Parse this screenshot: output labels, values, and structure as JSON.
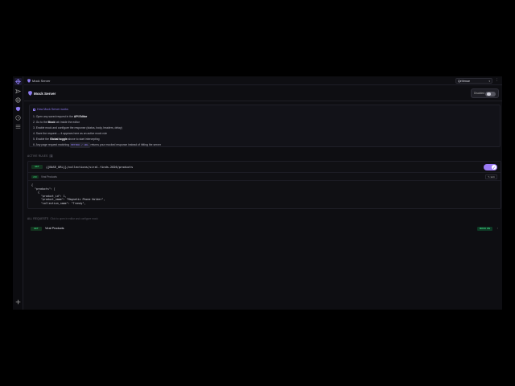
{
  "topbar": {
    "title": "Mock Server",
    "environment": "QeVenue",
    "menu_glyph": "⋮"
  },
  "header": {
    "title": "Mock Server",
    "global_toggle_label": "Disabled",
    "global_toggle_on": false
  },
  "howto": {
    "title": "How Mock Server works",
    "steps": [
      {
        "pre": "1. Open any saved request in the ",
        "bold": "API Editor",
        "post": ""
      },
      {
        "pre": "2. Go to the ",
        "bold": "Mock",
        "post": " tab inside the editor"
      },
      {
        "pre": "3. Enable mock and configure the response (status, body, headers, delay)",
        "bold": "",
        "post": ""
      },
      {
        "pre": "4. Save the request — it appears here as an active mock rule",
        "bold": "",
        "post": ""
      },
      {
        "pre": "5. Enable the ",
        "bold": "Global toggle",
        "post": " above to start intercepting"
      },
      {
        "pre": "6. Any page request matching ",
        "chip": "METHOD / URL",
        "post": " returns your mocked response instead of hitting the server"
      }
    ]
  },
  "active_rules": {
    "label": "ACTIVE RULES",
    "count": "1",
    "method": "GET",
    "url": "{{BASE_URL}}/collections/viral-finds-2026/products",
    "enabled": true,
    "status": "200",
    "name": "Viral Products",
    "edit_label": "✎ Edit",
    "body_lines": [
      "{",
      "  \"products\": [",
      "    {",
      "      \"product_id\": 1,",
      "      \"product_name\": \"Magnetic Phone Holder\",",
      "      \"collection_name\": \"Trendy\","
    ]
  },
  "all_requests": {
    "label": "ALL REQUESTS",
    "hint": "Click to open in editor and configure mock",
    "rows": [
      {
        "method": "GET",
        "name": "Viral Products",
        "badge": "MOCK ON"
      }
    ]
  },
  "colors": {
    "accent": "#9b7bf6",
    "get_green": "#3bd07a",
    "background": "#0e0e12"
  },
  "icons": {
    "rail": [
      "crosshair-icon",
      "send-icon",
      "globe-icon",
      "shield-icon",
      "history-icon",
      "list-icon"
    ],
    "rail_bottom": "plus-icon"
  }
}
